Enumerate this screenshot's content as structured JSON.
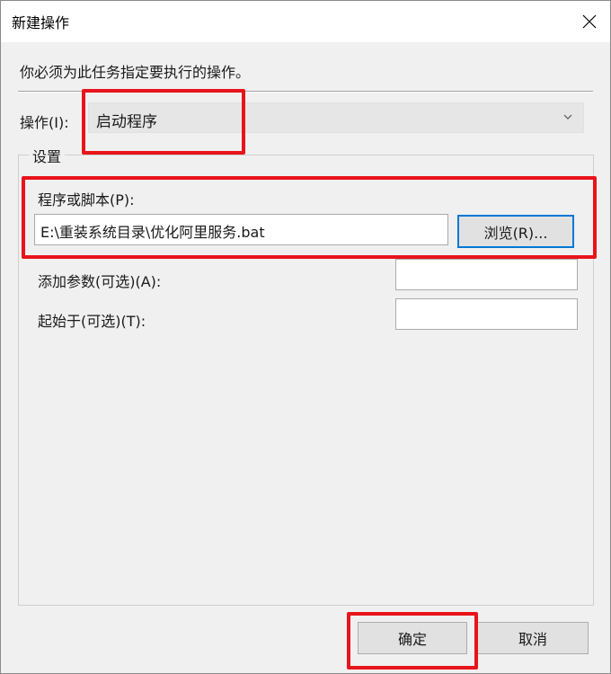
{
  "window": {
    "title": "新建操作"
  },
  "instruction": "你必须为此任务指定要执行的操作。",
  "action": {
    "label": "操作(I):",
    "selected": "启动程序"
  },
  "settings": {
    "group_title": "设置",
    "program": {
      "label": "程序或脚本(P):",
      "value": "E:\\重装系统目录\\优化阿里服务.bat",
      "browse_label": "浏览(R)..."
    },
    "arguments": {
      "label": "添加参数(可选)(A):",
      "value": ""
    },
    "start_in": {
      "label": "起始于(可选)(T):",
      "value": ""
    }
  },
  "footer": {
    "ok_label": "确定",
    "cancel_label": "取消"
  },
  "colors": {
    "annotation": "#e8141b",
    "focus": "#0078d7"
  },
  "icons": {
    "close": "close-icon",
    "dropdown": "chevron-down-icon"
  }
}
